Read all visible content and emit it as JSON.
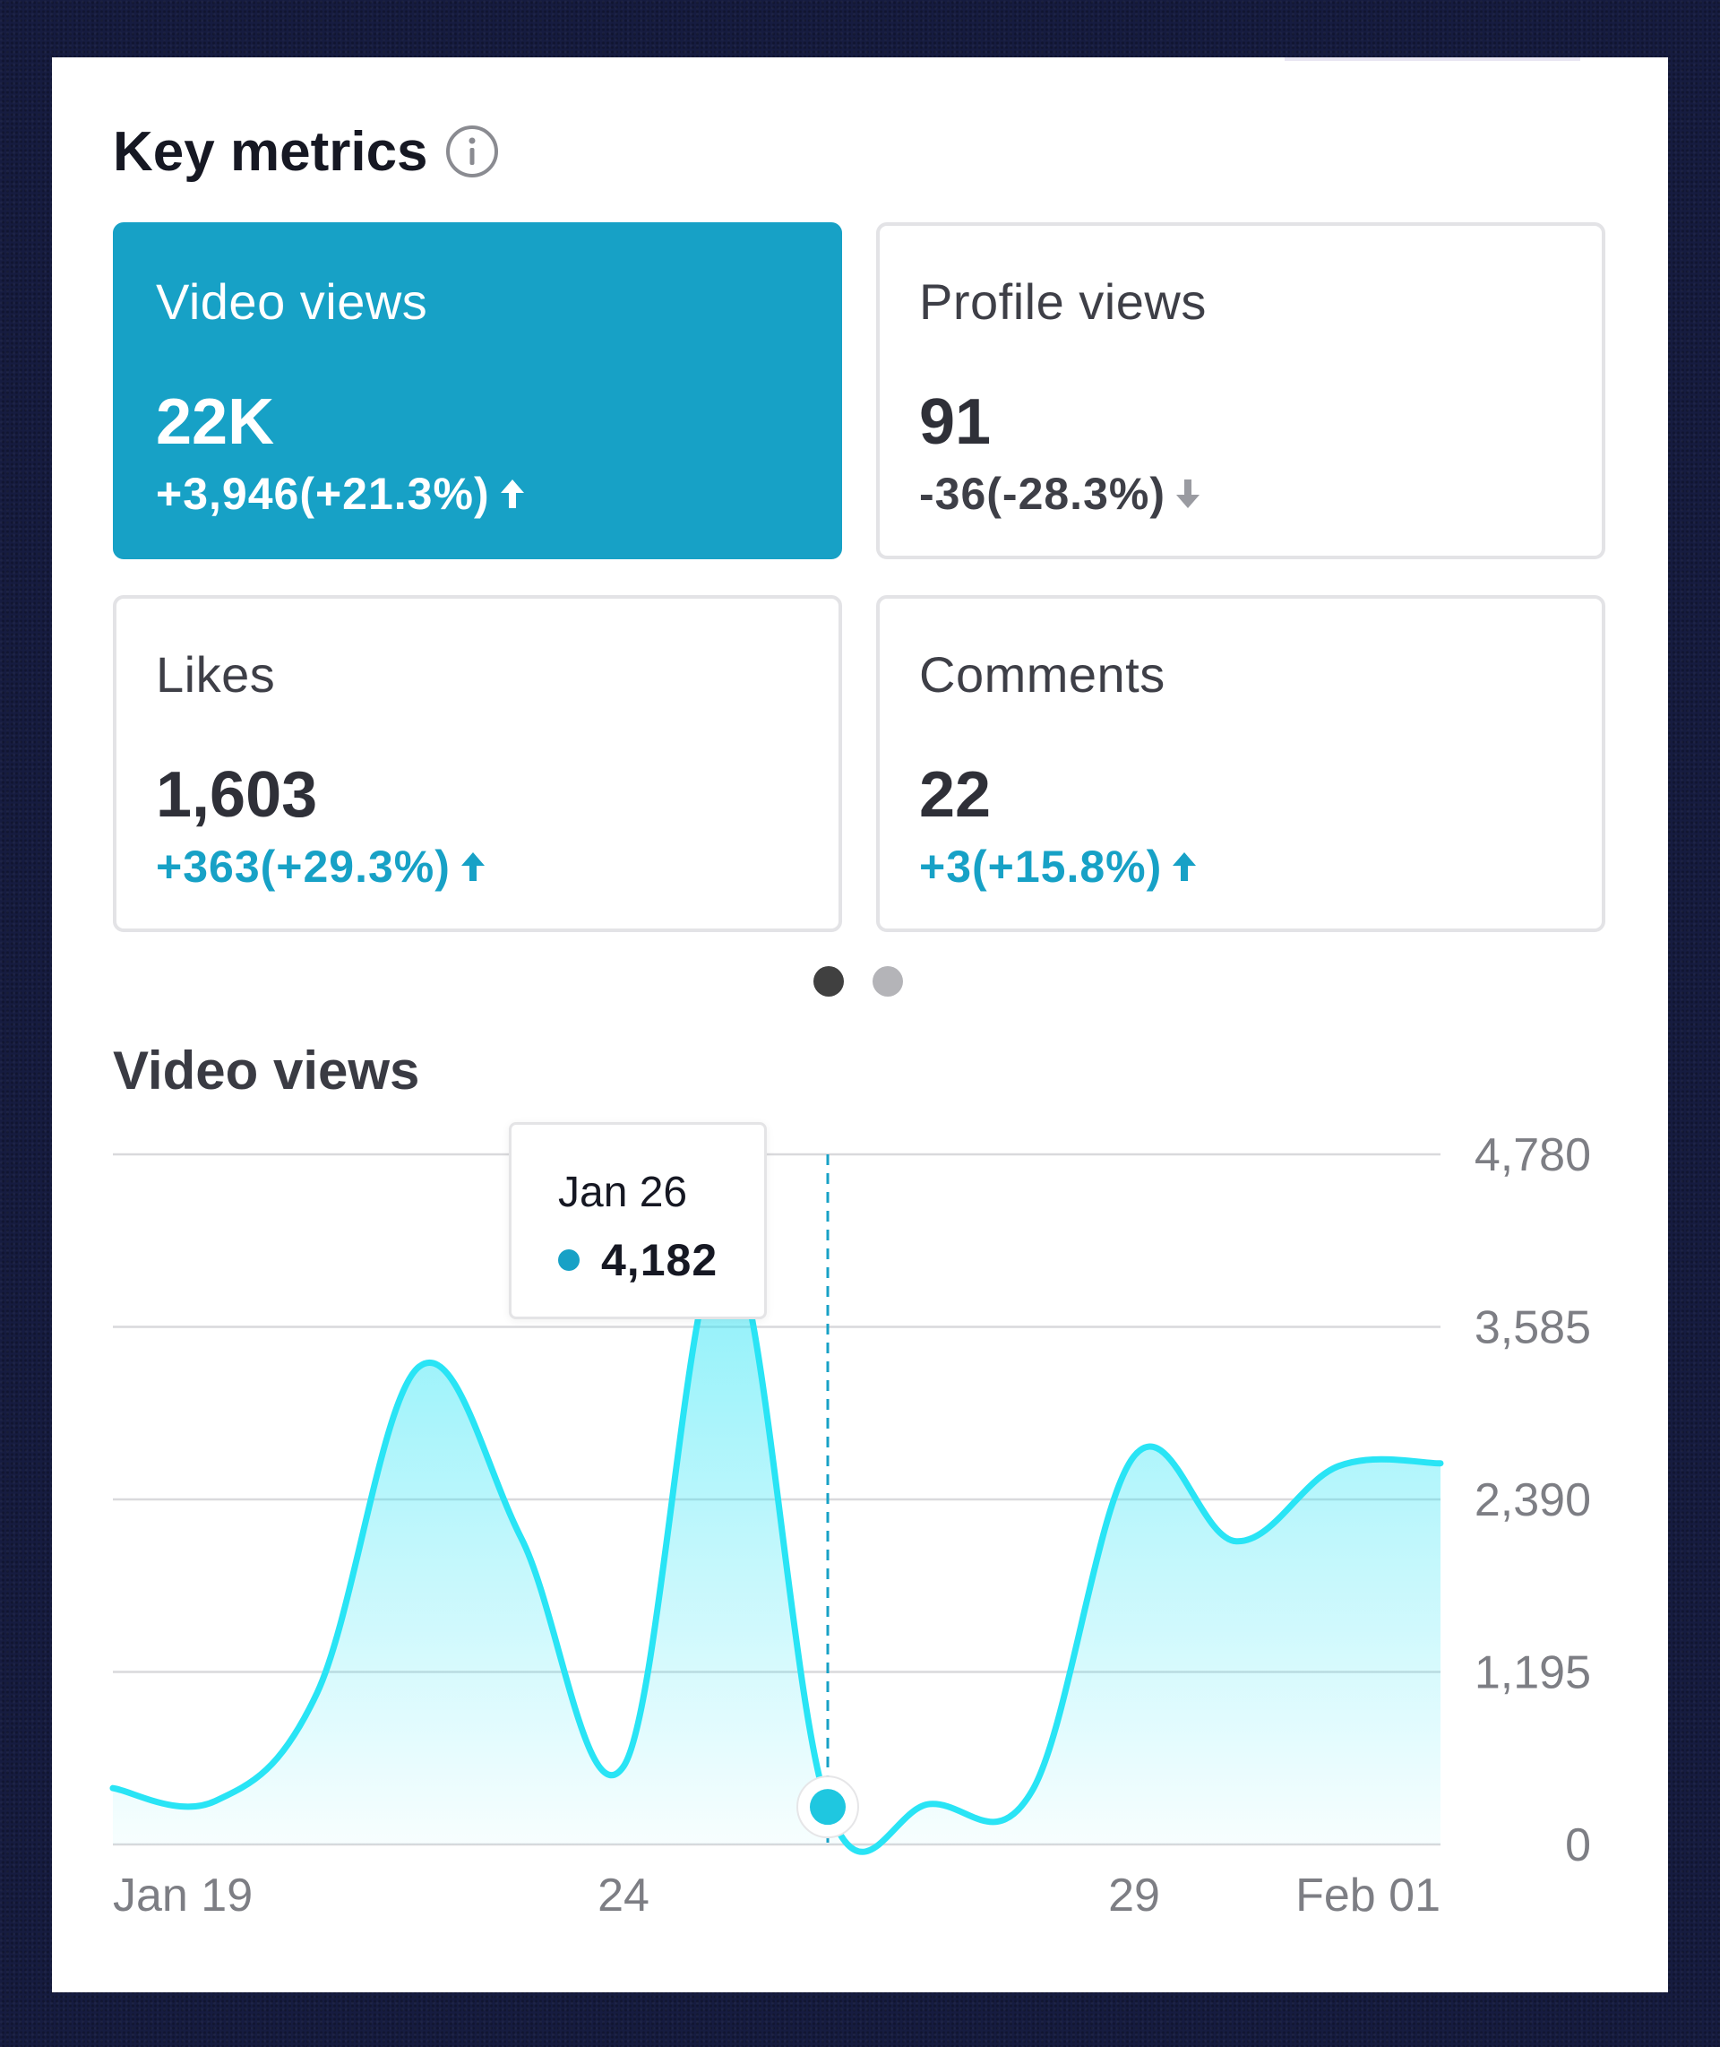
{
  "key_metrics": {
    "title": "Key metrics",
    "info_icon": "info-icon",
    "tiles": [
      {
        "label": "Video views",
        "value": "22K",
        "change": "+3,946(+21.3%)",
        "trend": "up",
        "active": true
      },
      {
        "label": "Profile views",
        "value": "91",
        "change": "-36(-28.3%)",
        "trend": "down",
        "active": false
      },
      {
        "label": "Likes",
        "value": "1,603",
        "change": "+363(+29.3%)",
        "trend": "up",
        "active": false
      },
      {
        "label": "Comments",
        "value": "22",
        "change": "+3(+15.8%)",
        "trend": "up",
        "active": false
      }
    ],
    "pagination": {
      "pages": 2,
      "current": 1
    }
  },
  "colors": {
    "accent": "#17a1c6",
    "line": "#29e4f5",
    "negative": "#3e3f47"
  },
  "chart_data": {
    "type": "area",
    "title": "Video views",
    "x_ticks": [
      "Jan 19",
      "24",
      "29",
      "Feb 01"
    ],
    "y_ticks": [
      "4,780",
      "3,585",
      "2,390",
      "1,195",
      "0"
    ],
    "ylim": [
      0,
      4780
    ],
    "series": [
      {
        "x": [
          "Jan 19",
          "Jan 20",
          "Jan 21",
          "Jan 22",
          "Jan 23",
          "Jan 24",
          "Jan 25",
          "Jan 26",
          "Jan 27",
          "Jan 28",
          "Jan 29",
          "Jan 30",
          "Jan 31",
          "Feb 01"
        ],
        "values": [
          390,
          300,
          1050,
          3310,
          2120,
          540,
          4182,
          260,
          280,
          370,
          2690,
          2100,
          2620,
          2640
        ]
      }
    ],
    "tooltip": {
      "date": "Jan 26",
      "value": "4,182"
    },
    "grid": true
  }
}
